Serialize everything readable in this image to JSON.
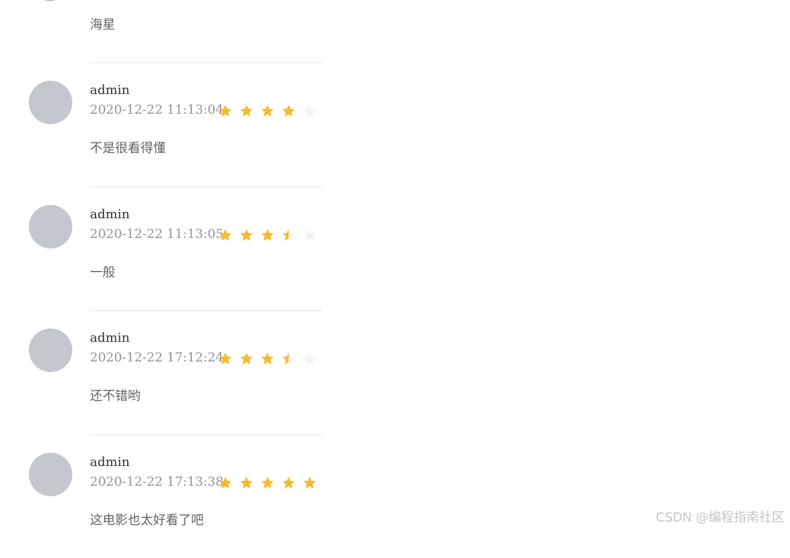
{
  "first_comment": {
    "content": "海星"
  },
  "comments": [
    {
      "author": "admin",
      "date": "2020-12-22 11:13:04",
      "rating": 4,
      "content": "不是很看得懂"
    },
    {
      "author": "admin",
      "date": "2020-12-22 11:13:05",
      "rating": 3.5,
      "content": "一般"
    },
    {
      "author": "admin",
      "date": "2020-12-22 17:12:24",
      "rating": 3.5,
      "content": "还不错哟"
    },
    {
      "author": "admin",
      "date": "2020-12-22 17:13:38",
      "rating": 5,
      "content": "这电影也太好看了吧"
    }
  ],
  "rating_max": 5,
  "colors": {
    "star_on": "#f7ba2a",
    "star_off": "#eff2f7",
    "avatar": "#c4c7cd",
    "divider": "#e4e7ed"
  },
  "icons": {
    "star": "star-icon",
    "avatar": "user-avatar"
  },
  "watermark": "CSDN @编程指南社区"
}
